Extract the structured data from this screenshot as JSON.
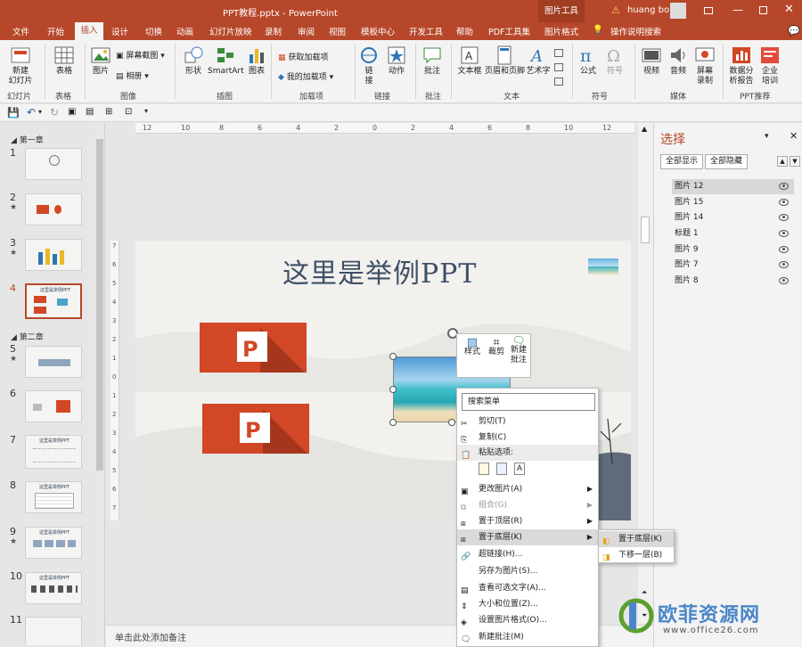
{
  "window": {
    "title": "PPT教程.pptx  -  PowerPoint",
    "context_tab": "图片工具",
    "user": "huang bo"
  },
  "tabs": [
    "文件",
    "开始",
    "插入",
    "设计",
    "切换",
    "动画",
    "幻灯片放映",
    "录制",
    "审阅",
    "视图",
    "模板中心",
    "开发工具",
    "帮助",
    "PDF工具集",
    "图片格式",
    "操作说明搜索"
  ],
  "ribbon": {
    "new_slide": "新建\n幻灯片",
    "table": "表格",
    "picture": "图片",
    "screenshot": "屏幕截图",
    "album": "相册",
    "shapes": "形状",
    "smartart": "SmartArt",
    "chart": "图表",
    "get_addins": "获取加载项",
    "my_addins": "我的加载项",
    "link": "链\n接",
    "action": "动作",
    "comment": "批注",
    "textbox": "文本框",
    "header_footer": "页眉和页脚",
    "wordart": "艺术字",
    "formula": "公式",
    "symbol": "符号",
    "video": "视频",
    "audio": "音频",
    "screen_record": "屏幕\n录制",
    "data_analysis": "数据分\n析报告",
    "training": "企业\n培训",
    "groups": [
      "幻灯片",
      "表格",
      "图像",
      "插图",
      "加载项",
      "链接",
      "批注",
      "文本",
      "符号",
      "媒体",
      "PPT推荐"
    ]
  },
  "thumbnails": {
    "sections": [
      "第一章",
      "第二章"
    ],
    "numbers": [
      "1",
      "2",
      "3",
      "4",
      "5",
      "6",
      "7",
      "8",
      "9",
      "10",
      "11"
    ],
    "star": "★",
    "texts": [
      "这里是举例PPT"
    ]
  },
  "slide": {
    "title": "这里是举例PPT"
  },
  "notes": {
    "placeholder": "单击此处添加备注"
  },
  "selection_pane": {
    "title": "选择",
    "show_all": "全部显示",
    "hide_all": "全部隐藏",
    "items": [
      "图片 12",
      "图片 15",
      "图片 14",
      "标题 1",
      "图片 9",
      "图片 7",
      "图片 8"
    ]
  },
  "mini_toolbar": {
    "style": "样式",
    "crop": "裁剪",
    "new_comment": "新建\n批注"
  },
  "context_menu": {
    "search": "搜索菜单",
    "items": [
      "剪切(T)",
      "复制(C)",
      "粘贴选项:",
      "更改图片(A)",
      "组合(G)",
      "置于顶层(R)",
      "置于底层(K)",
      "超链接(H)...",
      "另存为图片(S)...",
      "查看可选文字(A)...",
      "大小和位置(Z)...",
      "设置图片格式(O)...",
      "新建批注(M)"
    ]
  },
  "submenu": {
    "items": [
      "置于底层(K)",
      "下移一层(B)"
    ]
  },
  "ruler_h": [
    "12",
    "10",
    "8",
    "6",
    "4",
    "2",
    "0",
    "2",
    "4",
    "6",
    "8",
    "10",
    "12"
  ],
  "ruler_v": [
    "7",
    "6",
    "5",
    "4",
    "3",
    "2",
    "1",
    "0",
    "1",
    "2",
    "3",
    "4",
    "5",
    "6",
    "7"
  ],
  "watermark": {
    "text": "欧菲资源网",
    "url": "www.office26.com"
  }
}
